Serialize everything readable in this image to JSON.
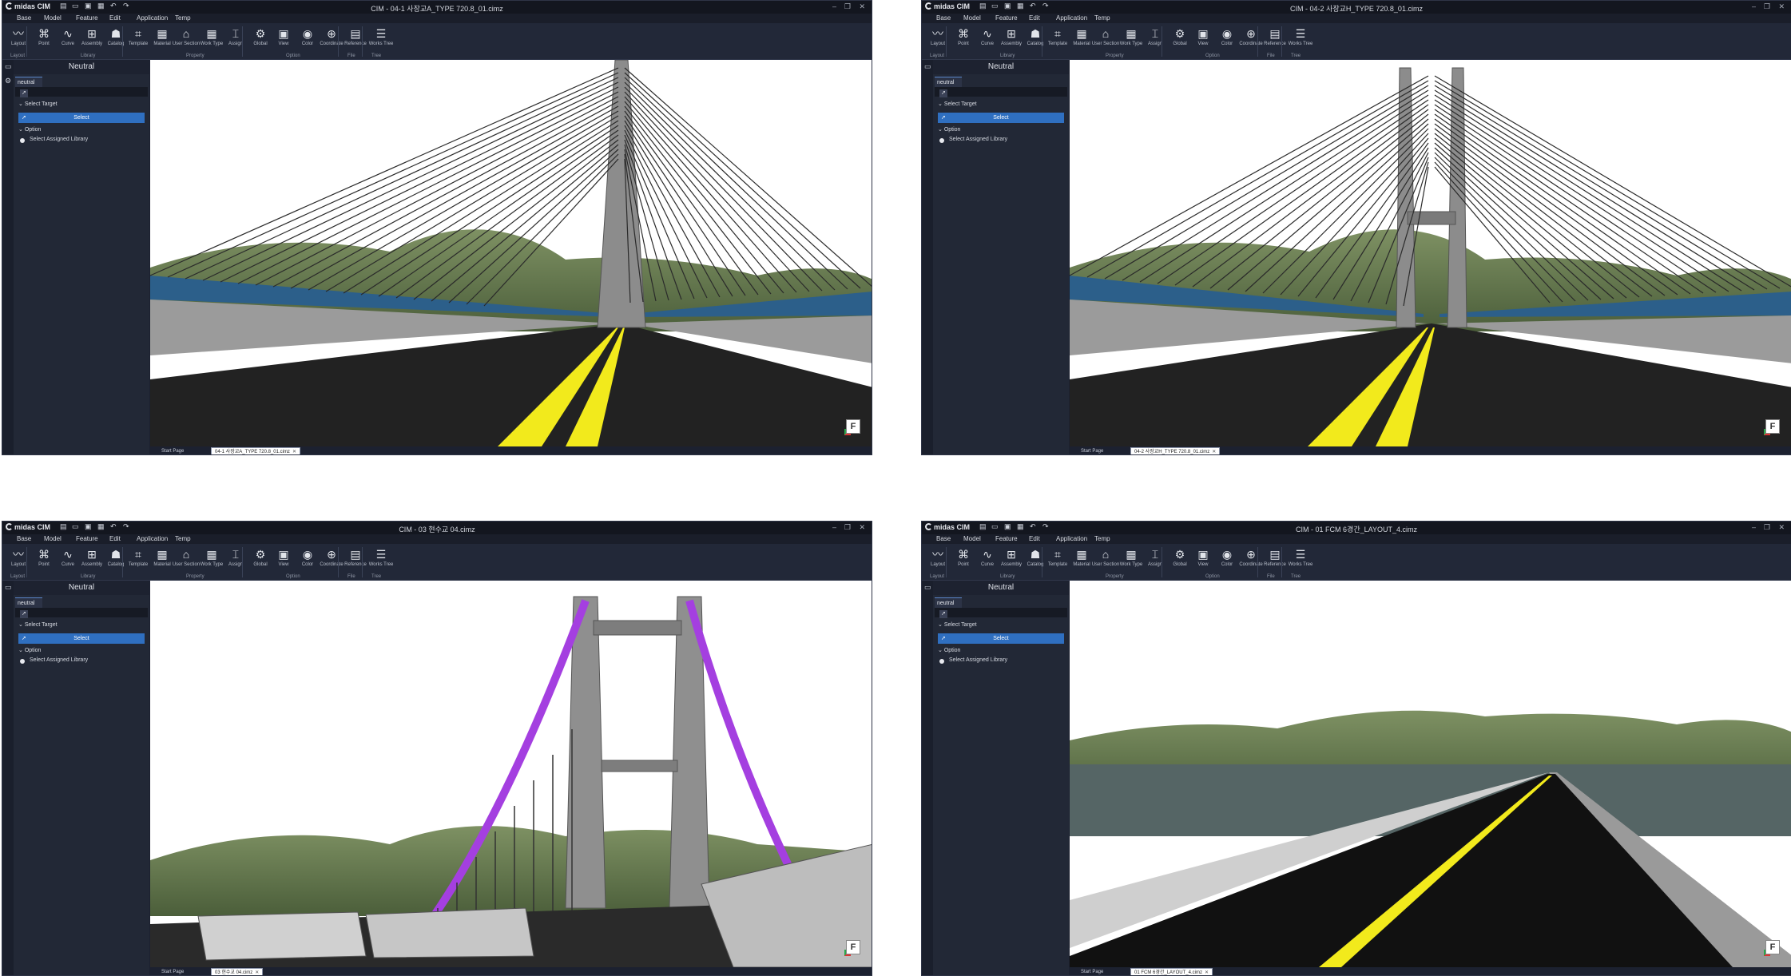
{
  "app": {
    "brand": "midas CIM",
    "menus": [
      "Base",
      "Model",
      "Feature",
      "Edit",
      "Application",
      "Temp"
    ],
    "ribbon_buttons": [
      {
        "label": "Layout",
        "icon": "layout-icon"
      },
      {
        "label": "Point",
        "icon": "point-icon"
      },
      {
        "label": "Curve",
        "icon": "curve-icon"
      },
      {
        "label": "Assembly",
        "icon": "assembly-icon"
      },
      {
        "label": "Catalog",
        "icon": "catalog-icon"
      },
      {
        "label": "Template",
        "icon": "template-icon"
      },
      {
        "label": "Material",
        "icon": "material-icon"
      },
      {
        "label": "User Section",
        "icon": "user-section-icon"
      },
      {
        "label": "Work Type",
        "icon": "work-type-icon"
      },
      {
        "label": "Assign",
        "icon": "assign-icon"
      },
      {
        "label": "Global",
        "icon": "global-icon"
      },
      {
        "label": "View",
        "icon": "view-icon"
      },
      {
        "label": "Color",
        "icon": "color-icon"
      },
      {
        "label": "Coordinate",
        "icon": "coordinate-icon"
      },
      {
        "label": "Reference",
        "icon": "reference-icon"
      },
      {
        "label": "Works Tree",
        "icon": "works-tree-icon"
      }
    ],
    "ribbon_groups": [
      "Layout",
      "Library",
      "Property",
      "Option",
      "File",
      "Tree"
    ],
    "panel": {
      "title": "Neutral",
      "tab": "neutral",
      "select_target": "Select Target",
      "select_button": "Select",
      "option": "Option",
      "select_assigned_library": "Select Assigned Library"
    },
    "start_page": "Start Page"
  },
  "windows": [
    {
      "title": "CIM - 04-1 사장교A_TYPE 720.8_01.cimz",
      "file_tab": "04-1 사장교A_TYPE 720.8_01.cimz",
      "scene": "cable-stayed-a"
    },
    {
      "title": "CIM - 04-2 사장교H_TYPE 720.8_01.cimz",
      "file_tab": "04-2 사장교H_TYPE 720.8_01.cimz",
      "scene": "cable-stayed-h"
    },
    {
      "title": "CIM - 03 현수교 04.cimz",
      "file_tab": "03 현수교 04.cimz",
      "scene": "suspension"
    },
    {
      "title": "CIM - 01 FCM 6경간_LAYOUT_4.cimz",
      "file_tab": "01 FCM 6경간_LAYOUT_4.cimz",
      "scene": "fcm-road"
    }
  ],
  "colors": {
    "accent": "#2f6fc0",
    "ui_bg": "#1c2130",
    "lane_marking": "#f2ea1c",
    "suspension_cable": "#a43fe0",
    "bridge_gray": "#9a9a9a",
    "hill_green": "#5d7548"
  },
  "viewport_badge": "F"
}
